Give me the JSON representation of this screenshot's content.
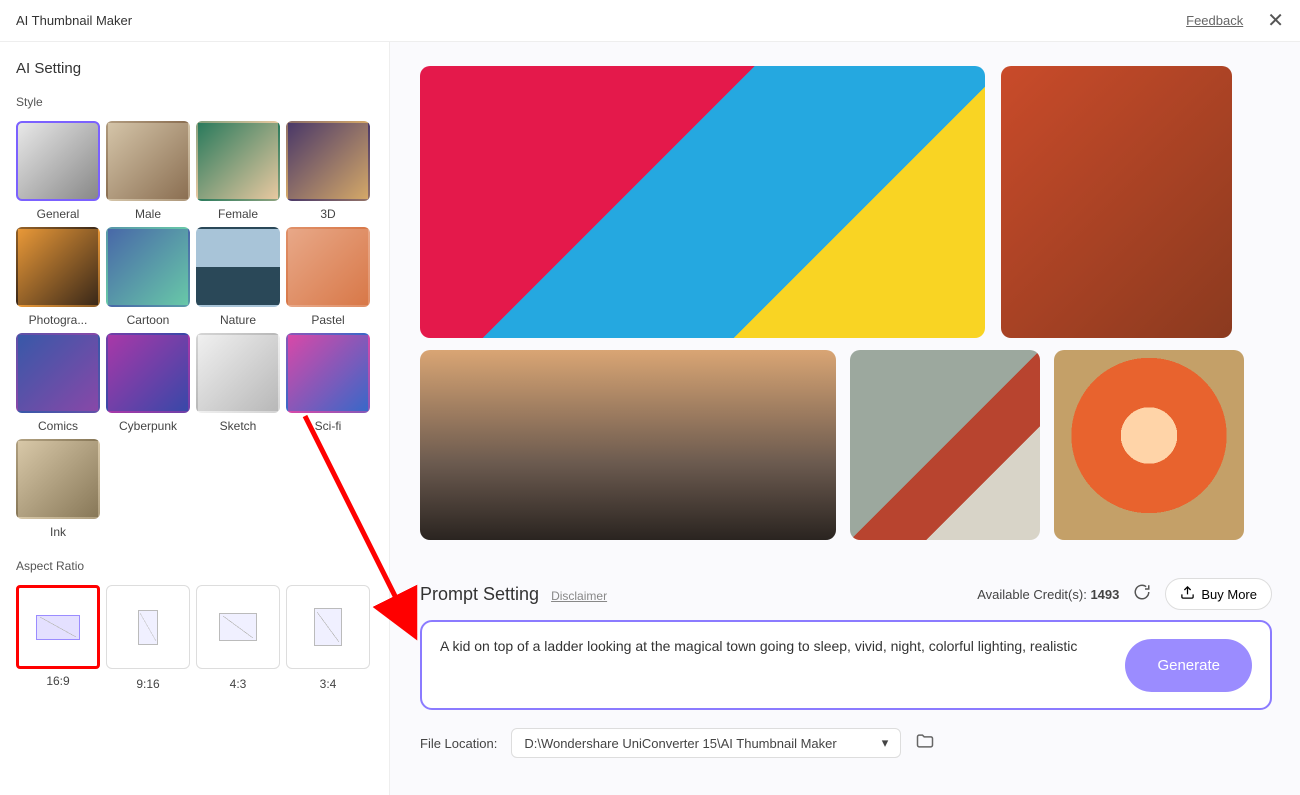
{
  "titlebar": {
    "title": "AI Thumbnail Maker",
    "feedback": "Feedback"
  },
  "sidebar": {
    "heading": "AI Setting",
    "style_label": "Style",
    "styles": [
      {
        "label": "General"
      },
      {
        "label": "Male"
      },
      {
        "label": "Female"
      },
      {
        "label": "3D"
      },
      {
        "label": "Photogra..."
      },
      {
        "label": "Cartoon"
      },
      {
        "label": "Nature"
      },
      {
        "label": "Pastel"
      },
      {
        "label": "Comics"
      },
      {
        "label": "Cyberpunk"
      },
      {
        "label": "Sketch"
      },
      {
        "label": "Sci-fi"
      },
      {
        "label": "Ink"
      }
    ],
    "aspect_label": "Aspect Ratio",
    "ratios": [
      {
        "label": "16:9"
      },
      {
        "label": "9:16"
      },
      {
        "label": "4:3"
      },
      {
        "label": "3:4"
      }
    ]
  },
  "prompt": {
    "title": "Prompt Setting",
    "disclaimer": "Disclaimer",
    "credits_label": "Available Credit(s): ",
    "credits_value": "1493",
    "buy_more": "Buy More",
    "text": "A kid on top of a ladder looking at the magical town going to sleep, vivid, night, colorful lighting, realistic",
    "generate": "Generate"
  },
  "file": {
    "label": "File Location:",
    "path": "D:\\Wondershare UniConverter 15\\AI Thumbnail Maker"
  }
}
